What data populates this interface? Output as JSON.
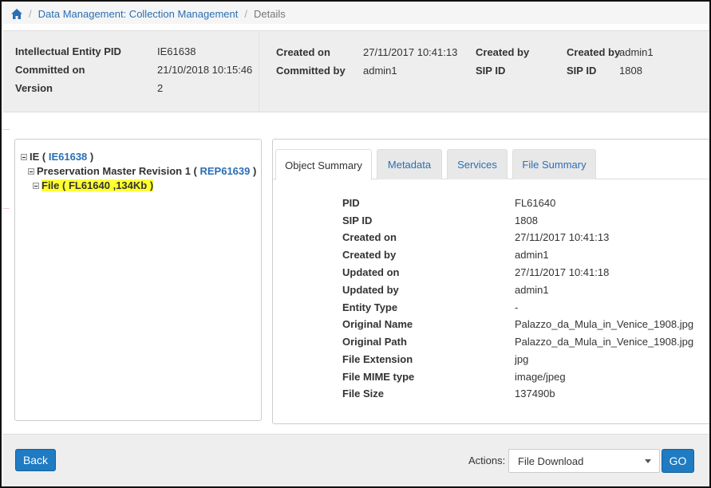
{
  "breadcrumb": {
    "link": "Data Management: Collection Management",
    "current": "Details"
  },
  "info": {
    "ie_pid_label": "Intellectual Entity PID",
    "ie_pid_value": "IE61638",
    "committed_on_label": "Committed on",
    "committed_on_value": "21/10/2018 10:15:46",
    "version_label": "Version",
    "version_value": "2",
    "created_on_label": "Created on",
    "created_on_value": "27/11/2017 10:41:13",
    "committed_by_label": "Committed by",
    "committed_by_value": "admin1",
    "created_by_label": "Created by",
    "created_by_value": "admin1",
    "sip_id_label": "SIP ID",
    "sip_id_value": "1808"
  },
  "tree": {
    "ie": {
      "prefix": "IE (",
      "pid": "IE61638",
      "suffix": ")"
    },
    "rep": {
      "prefix": "Preservation Master Revision 1 (",
      "pid": "REP61639",
      "suffix": ")"
    },
    "file": {
      "text": "File ( FL61640 ,134Kb )"
    }
  },
  "tabs": [
    "Object Summary",
    "Metadata",
    "Services",
    "File Summary"
  ],
  "details": [
    {
      "label": "PID",
      "value": "FL61640"
    },
    {
      "label": "SIP ID",
      "value": "1808"
    },
    {
      "label": "Created on",
      "value": "27/11/2017 10:41:13"
    },
    {
      "label": "Created by",
      "value": "admin1"
    },
    {
      "label": "Updated on",
      "value": "27/11/2017 10:41:18"
    },
    {
      "label": "Updated by",
      "value": "admin1"
    },
    {
      "label": "Entity Type",
      "value": "-"
    },
    {
      "label": "Original Name",
      "value": "Palazzo_da_Mula_in_Venice_1908.jpg"
    },
    {
      "label": "Original Path",
      "value": "Palazzo_da_Mula_in_Venice_1908.jpg"
    },
    {
      "label": "File Extension",
      "value": "jpg"
    },
    {
      "label": "File MIME type",
      "value": "image/jpeg"
    },
    {
      "label": "File Size",
      "value": "137490b"
    }
  ],
  "footer": {
    "back_label": "Back",
    "actions_label": "Actions:",
    "actions_selected": "File Download",
    "go_label": "GO"
  },
  "colors": {
    "link": "#2a6fb5",
    "primary_button": "#1f7bc2",
    "highlight": "#ffff33"
  },
  "icons": [
    "home-icon",
    "tree-toggle-icon",
    "dropdown-caret-icon"
  ]
}
